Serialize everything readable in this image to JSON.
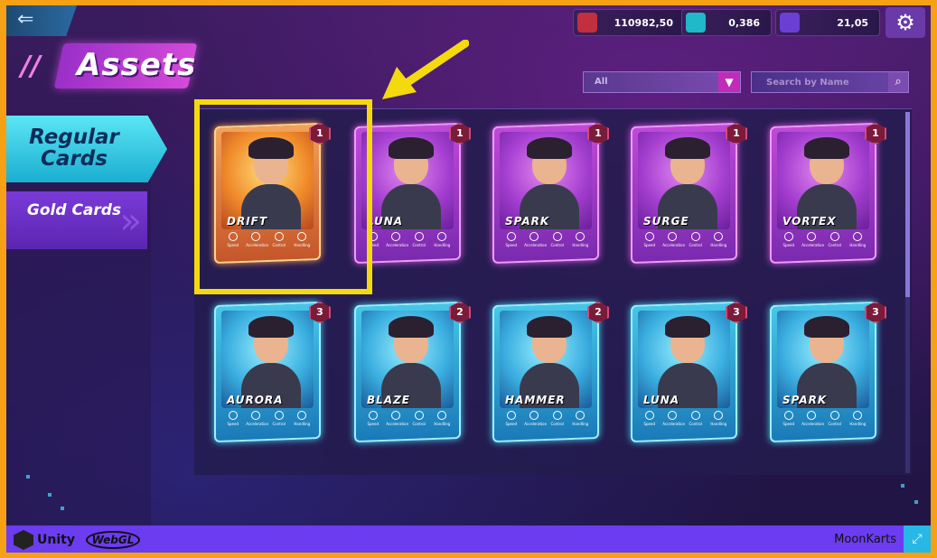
{
  "header": {
    "title": "Assets",
    "back_icon": "back-arrow-icon",
    "settings_icon": "gear-icon"
  },
  "currencies": [
    {
      "value": "110982,50",
      "icon": "red-kart-icon",
      "color": "#c22f3e"
    },
    {
      "value": "0,386",
      "icon": "cyan-token-icon",
      "color": "#1fb9c9"
    },
    {
      "value": "21,05",
      "icon": "purple-kart-icon",
      "color": "#6b3ed4"
    }
  ],
  "tabs": {
    "regular": "Regular Cards",
    "gold": "Gold Cards",
    "active": "regular"
  },
  "filter": {
    "selected": "All"
  },
  "search": {
    "placeholder": "Search by Name"
  },
  "cards": [
    {
      "name": "DRIFT",
      "level": "1",
      "rarity": "gold"
    },
    {
      "name": "LUNA",
      "level": "1",
      "rarity": "purple"
    },
    {
      "name": "SPARK",
      "level": "1",
      "rarity": "purple"
    },
    {
      "name": "SURGE",
      "level": "1",
      "rarity": "purple"
    },
    {
      "name": "VORTEX",
      "level": "1",
      "rarity": "purple"
    },
    {
      "name": "AURORA",
      "level": "3",
      "rarity": "cyan"
    },
    {
      "name": "BLAZE",
      "level": "2",
      "rarity": "cyan"
    },
    {
      "name": "HAMMER",
      "level": "2",
      "rarity": "cyan"
    },
    {
      "name": "LUNA",
      "level": "3",
      "rarity": "cyan"
    },
    {
      "name": "SPARK",
      "level": "3",
      "rarity": "cyan"
    }
  ],
  "stat_labels": [
    "Speed",
    "Acceleration",
    "Control",
    "Handling"
  ],
  "footer": {
    "engine": "Unity",
    "platform": "WebGL",
    "game_name": "MoonKarts"
  },
  "colors": {
    "highlight": "#f4d90e",
    "accent_cyan": "#5be6f5",
    "accent_purple": "#c04ad8",
    "frame_orange": "#f5a015"
  }
}
